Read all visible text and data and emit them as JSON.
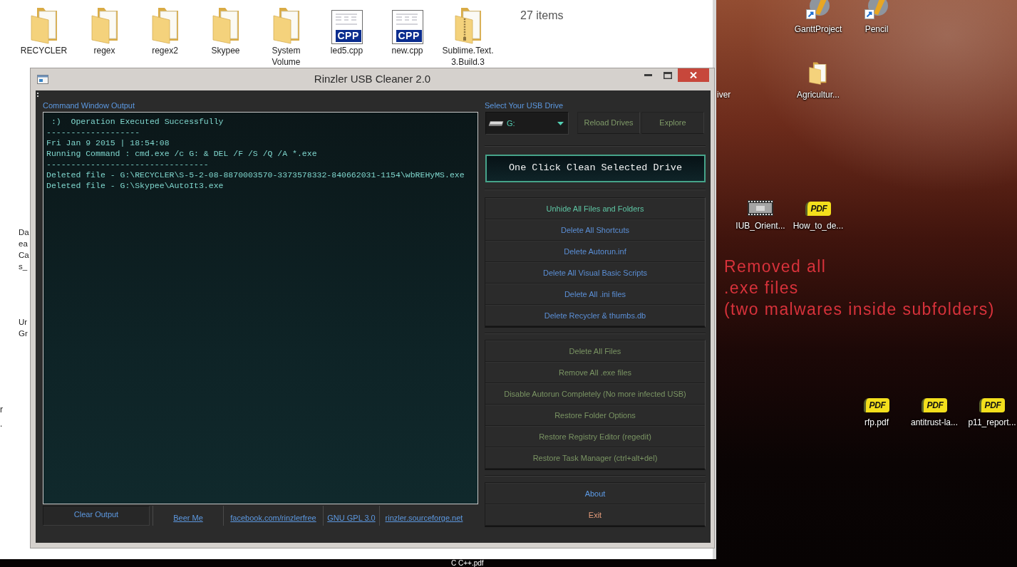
{
  "explorer": {
    "items": [
      {
        "label": "RECYCLER",
        "kind": "folder"
      },
      {
        "label": "regex",
        "kind": "folder"
      },
      {
        "label": "regex2",
        "kind": "folder"
      },
      {
        "label": "Skypee",
        "kind": "folder"
      },
      {
        "label": "System Volume",
        "kind": "folder"
      },
      {
        "label": "led5.cpp",
        "kind": "cpp",
        "badge": "CPP"
      },
      {
        "label": "new.cpp",
        "kind": "cpp",
        "badge": "CPP"
      },
      {
        "label": "Sublime.Text.3.Build.3",
        "kind": "zip"
      }
    ],
    "item_count": "27 items",
    "cut_labels": [
      {
        "lines": [
          "Da",
          "ea",
          "Ca",
          "s_"
        ]
      },
      {
        "lines": [
          "Ur",
          "Gr"
        ]
      }
    ],
    "edge_fragments": [
      "r",
      "."
    ]
  },
  "app_window": {
    "title": "Rinzler USB Cleaner 2.0",
    "output": {
      "label": "Command Window Output",
      "lines": [
        " :)  Operation Executed Successfully",
        "-------------------",
        "Fri Jan 9 2015 | 18:54:08",
        "Running Command : cmd.exe /c G: & DEL /F /S /Q /A *.exe",
        "---------------------------------",
        "Deleted file - G:\\RECYCLER\\S-5-2-08-8870003570-3373578332-840662031-1154\\wbREHyMS.exe",
        "Deleted file - G:\\Skypee\\AutoIt3.exe"
      ]
    },
    "clear_button": "Clear Output",
    "links": [
      "Beer Me",
      "facebook.com/rinzlerfree",
      "GNU GPL 3.0",
      "rinzler.sourceforge.net"
    ],
    "drive": {
      "label": "Select Your USB Drive",
      "value": "G:"
    },
    "drive_buttons": [
      "Reload Drives",
      "Explore"
    ],
    "clean_button": "One Click Clean Selected Drive",
    "button_groups": [
      [
        {
          "label": "Unhide All Files and Folders",
          "color": "#5fc7a5"
        },
        {
          "label": "Delete All Shortcuts",
          "color": "#5b8fd6"
        },
        {
          "label": "Delete Autorun.inf",
          "color": "#5b8fd6"
        },
        {
          "label": "Delete All Visual Basic Scripts",
          "color": "#5b8fd6"
        },
        {
          "label": "Delete All .ini files",
          "color": "#5b8fd6"
        },
        {
          "label": "Delete Recycler & thumbs.db",
          "color": "#5b8fd6"
        }
      ],
      [
        {
          "label": "Delete All Files",
          "color": "#7a9463"
        },
        {
          "label": "Remove All .exe files",
          "color": "#7a9463"
        },
        {
          "label": "Disable Autorun Completely (No more infected USB)",
          "color": "#7a9463"
        },
        {
          "label": "Restore Folder Options",
          "color": "#7a9463"
        },
        {
          "label": "Restore Registry Editor (regedit)",
          "color": "#7a9463"
        },
        {
          "label": "Restore Task Manager (ctrl+alt+del)",
          "color": "#7a9463"
        }
      ],
      [
        {
          "label": "About",
          "color": "#5d9be6"
        },
        {
          "label": "Exit",
          "color": "#e39b7a"
        }
      ]
    ]
  },
  "desktop": {
    "icons": [
      {
        "label": "GanttProject",
        "kind": "shortcut"
      },
      {
        "label": "Pencil",
        "kind": "shortcut"
      },
      {
        "label": "Agricultur...",
        "kind": "folder"
      },
      {
        "label": "IUB_Orient...",
        "kind": "video"
      },
      {
        "label": "How_to_de...",
        "kind": "pdf",
        "badge": "PDF"
      },
      {
        "label": "rfp.pdf",
        "kind": "pdf",
        "badge": "PDF"
      },
      {
        "label": "antitrust-la...",
        "kind": "pdf",
        "badge": "PDF"
      },
      {
        "label": "p11_report...",
        "kind": "pdf",
        "badge": "PDF"
      }
    ],
    "fragments": [
      "iver"
    ],
    "annotation": {
      "lines": [
        "Removed all",
        ".exe files",
        "(two malwares inside subfolders)"
      ]
    },
    "bottom_label": "C C++.pdf"
  }
}
